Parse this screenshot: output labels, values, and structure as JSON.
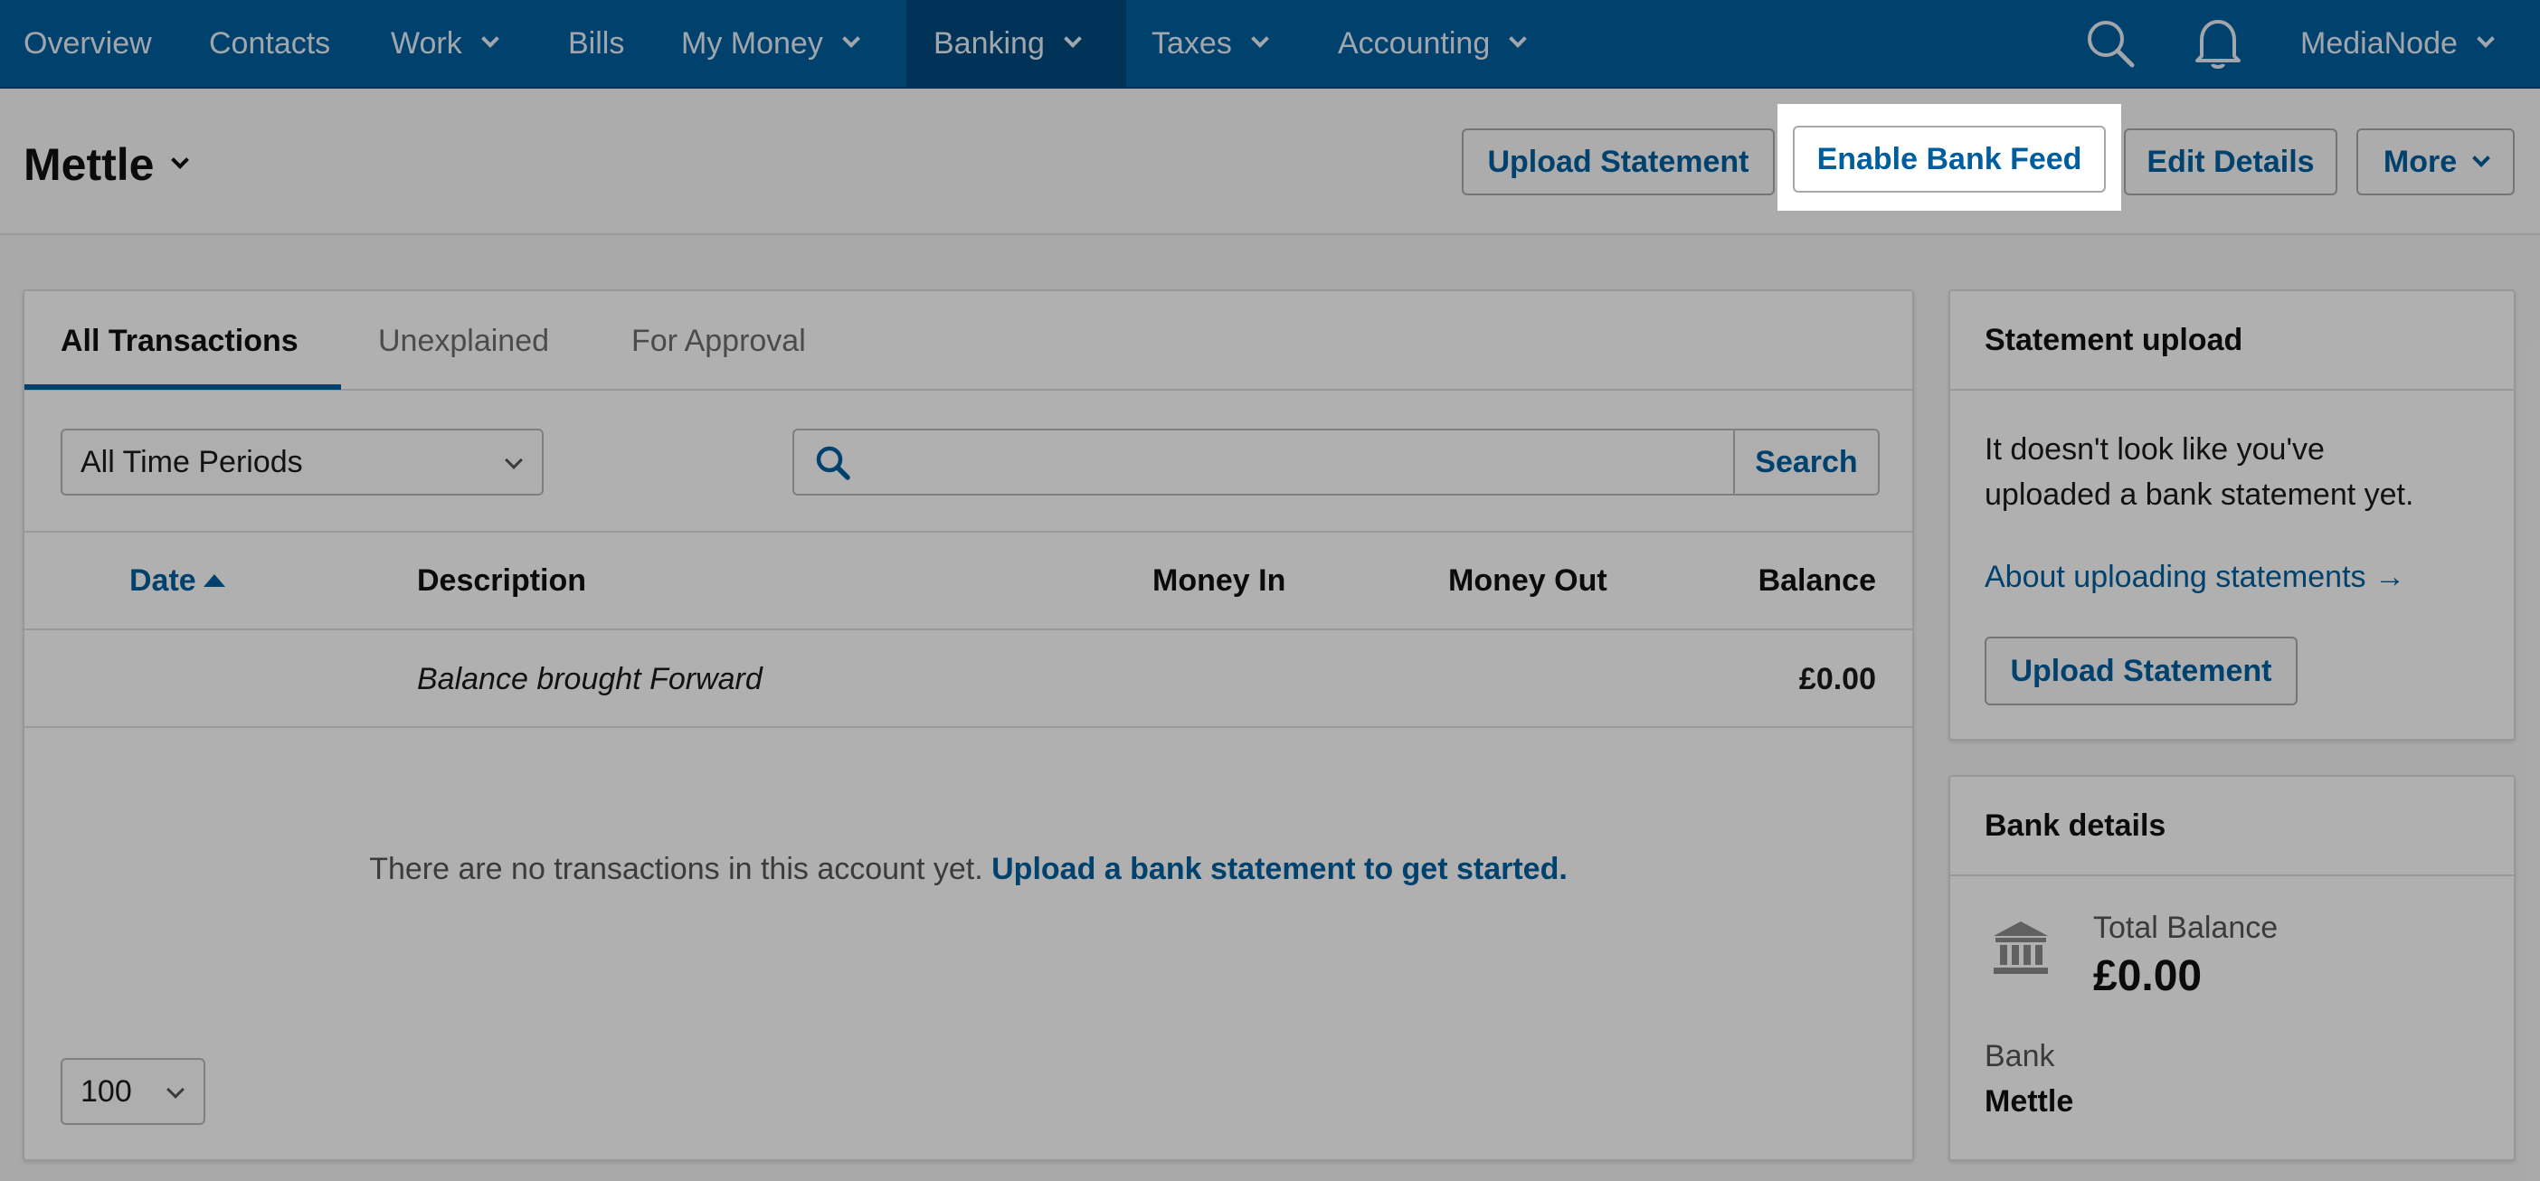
{
  "nav": {
    "items": [
      {
        "label": "Overview",
        "dropdown": false
      },
      {
        "label": "Contacts",
        "dropdown": false
      },
      {
        "label": "Work",
        "dropdown": true
      },
      {
        "label": "Bills",
        "dropdown": false
      },
      {
        "label": "My Money",
        "dropdown": true
      },
      {
        "label": "Banking",
        "dropdown": true,
        "active": true
      },
      {
        "label": "Taxes",
        "dropdown": true
      },
      {
        "label": "Accounting",
        "dropdown": true
      }
    ],
    "user_label": "MediaNode",
    "search_icon": "search-icon",
    "notifications_icon": "bell-icon"
  },
  "header": {
    "account_name": "Mettle",
    "buttons": {
      "upload_statement": "Upload Statement",
      "enable_bank_feed": "Enable Bank Feed",
      "edit_details": "Edit Details",
      "more": "More"
    }
  },
  "transactions": {
    "tabs": [
      "All Transactions",
      "Unexplained",
      "For Approval"
    ],
    "active_tab": "All Transactions",
    "period_filter": "All Time Periods",
    "search_button": "Search",
    "search_placeholder": "",
    "columns": [
      "Date",
      "Description",
      "Money In",
      "Money Out",
      "Balance"
    ],
    "sort_column": "Date",
    "rows": [
      {
        "date": "",
        "description": "Balance brought Forward",
        "money_in": "",
        "money_out": "",
        "balance": "£0.00"
      }
    ],
    "empty_message": "There are no transactions in this account yet.",
    "empty_link": "Upload a bank statement to get started.",
    "page_size": "100"
  },
  "statement_upload": {
    "title": "Statement upload",
    "text_line1": "It doesn't look like you've",
    "text_line2": "uploaded a bank statement yet.",
    "link": "About uploading statements →",
    "button": "Upload Statement"
  },
  "bank_details": {
    "title": "Bank details",
    "total_balance_label": "Total Balance",
    "total_balance_value": "£0.00",
    "bank_label": "Bank",
    "bank_value": "Mettle",
    "icon": "bank-icon"
  },
  "colors": {
    "nav_bg": "#005e9d",
    "accent": "#005e9d"
  }
}
